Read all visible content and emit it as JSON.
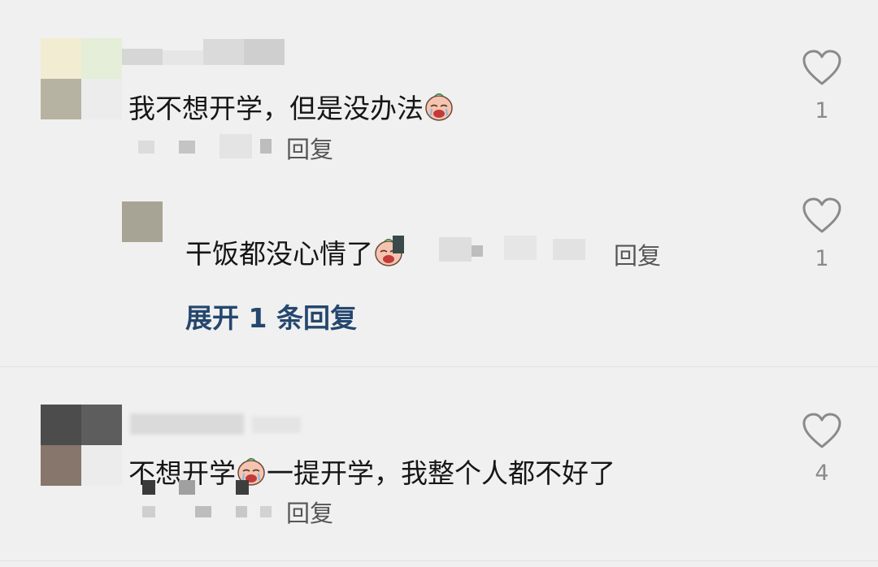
{
  "comments": [
    {
      "text": "我不想开学，但是没办法",
      "reply_label": "回复",
      "likes": "1",
      "emoji": "crying-face-emoji",
      "replies": [
        {
          "text": "干饭都没心情了",
          "reply_label": "回复",
          "likes": "1",
          "emoji": "crying-face-emoji"
        }
      ],
      "expand_label": "展开 1 条回复"
    },
    {
      "text_before_emoji": "不想开学",
      "text_after_emoji": "一提开学，我整个人都不好了",
      "reply_label": "回复",
      "likes": "4",
      "emoji": "crying-face-emoji"
    }
  ],
  "colors": {
    "background": "#f0f0f0",
    "expand_link": "#24476e",
    "like_count": "#8a8a8a"
  },
  "icons": [
    "heart-outline-icon",
    "crying-face-emoji"
  ]
}
